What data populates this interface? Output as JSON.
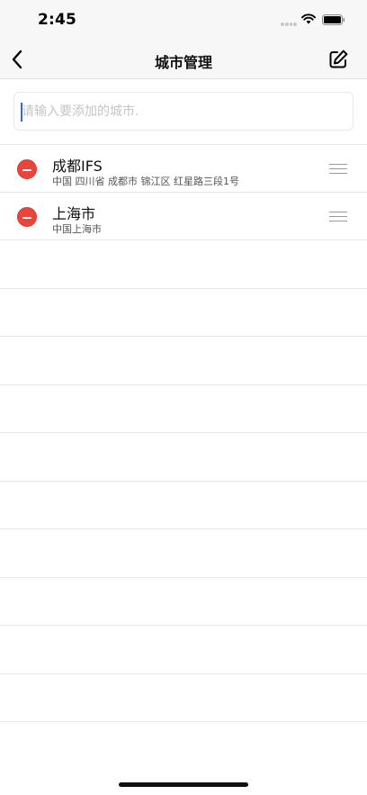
{
  "status_bar": {
    "time": "2:45",
    "icons": [
      "signal-dots-icon",
      "wifi-icon",
      "battery-icon"
    ]
  },
  "nav": {
    "title": "城市管理",
    "back_icon": "chevron-left-icon",
    "edit_icon": "edit-pencil-icon"
  },
  "search": {
    "placeholder": "请输入要添加的城市.",
    "value": ""
  },
  "cities": [
    {
      "name": "成都IFS",
      "address": "中国 四川省 成都市 锦江区 红星路三段1号"
    },
    {
      "name": "上海市",
      "address": "中国上海市"
    }
  ],
  "colors": {
    "delete": "#e8453c",
    "accent": "#3d63dd",
    "bar_background": "#f7f7f7",
    "divider": "#e6e6e6"
  }
}
